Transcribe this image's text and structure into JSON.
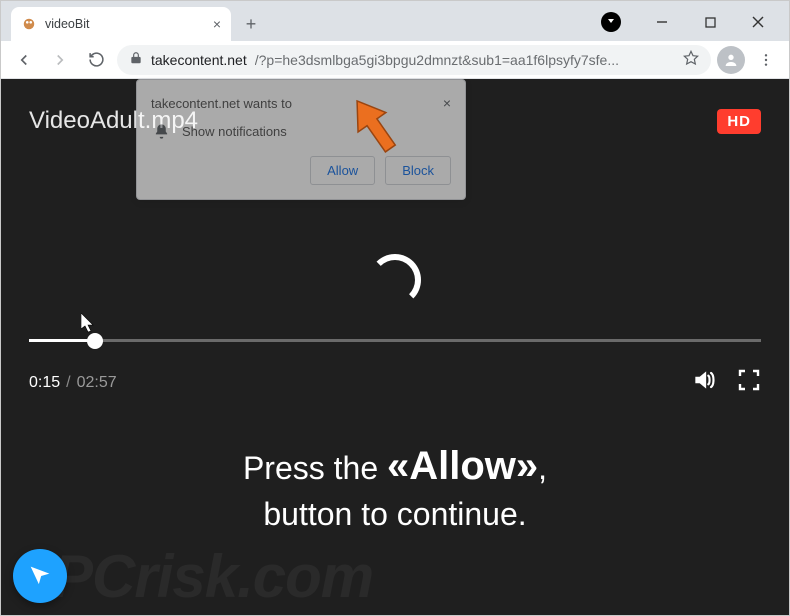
{
  "tab": {
    "title": "videoBit"
  },
  "url": {
    "host": "takecontent.net",
    "path": "/?p=he3dsmlbga5gi3bpgu2dmnzt&sub1=aa1f6lpsyfy7sfe..."
  },
  "notification": {
    "host_wants": "takecontent.net wants to",
    "show_label": "Show notifications",
    "allow": "Allow",
    "block": "Block"
  },
  "video": {
    "filename": "VideoAdult.mp4",
    "hd": "HD",
    "time_current": "0:15",
    "time_total": "02:57"
  },
  "big_message": {
    "line1_pre": "Press the ",
    "allow_word": "«Allow»",
    "line1_post": ",",
    "line2": "button to continue."
  },
  "watermark": "PCrisk.com",
  "icons": {
    "bell": "bell-icon",
    "lock": "lock-icon",
    "star": "star-icon",
    "volume": "volume-icon",
    "fullscreen": "fullscreen-icon",
    "pointer": "pointer-icon",
    "profile": "profile-icon"
  }
}
